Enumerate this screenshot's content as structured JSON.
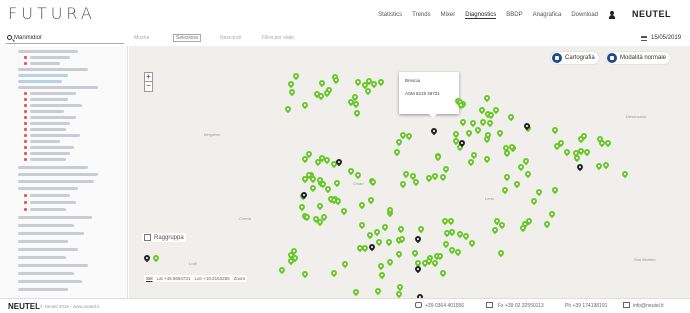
{
  "header": {
    "logo": "FUTURA",
    "nav": [
      "Statistics",
      "Trends",
      "Mixer",
      "Diagnostics",
      "BBDP",
      "Anagrafica",
      "Download"
    ],
    "active_nav": 3,
    "brand": "NEUTEL"
  },
  "toolbar": {
    "search_value": "Manmidior",
    "tabs": [
      "Mostra",
      "Seleziona",
      "Nascondi",
      "Filtra per stato"
    ],
    "active_tab": 1,
    "date": "15/05/2019"
  },
  "map": {
    "buttons": {
      "cartography": "Cartografia",
      "modality": "Modalità normale"
    },
    "zoom": {
      "in": "+",
      "out": "−"
    },
    "popup": {
      "title": "Brescia",
      "line": "ASM 8219 48721"
    },
    "regroup_label": "Raggruppa",
    "coords": {
      "label": "Sel",
      "lat": "Lat  +45.5664731",
      "lon": "Lon  +10.2163255",
      "extra": "Zoom"
    },
    "places": [
      "Bergamo",
      "Crema",
      "Lodi",
      "San Martino",
      "Desenzano",
      "Chiari",
      "Leno"
    ]
  },
  "footer": {
    "brand": "NEUTEL",
    "copyright": "© Neutel 2019 - www.neutel.it",
    "phone": "+39 0364 401556",
    "fax": "Fx +39 02 32550113",
    "mobile": "Ph +39 174198191",
    "email": "info@neutel.it"
  },
  "colors": {
    "accent": "#1e4b8f",
    "pin_active": "#6ac72b",
    "pin_alarm": "#222222",
    "map_bg": "#f1efec"
  }
}
